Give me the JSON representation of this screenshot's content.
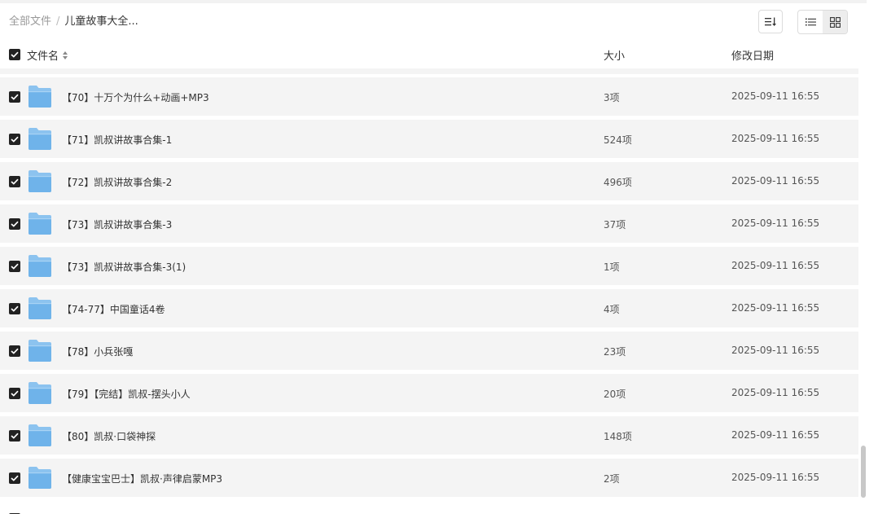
{
  "breadcrumb": {
    "root": "全部文件",
    "separator": "/",
    "current": "儿童故事大全..."
  },
  "toolbar": {
    "sort_icon": "sort-icon",
    "view_list_icon": "list-view-icon",
    "view_grid_icon": "grid-view-icon",
    "active_view": "grid"
  },
  "columns": {
    "name": "文件名",
    "size": "大小",
    "date": "修改日期"
  },
  "rows": [
    {
      "name": "【70】十万个为什么+动画+MP3",
      "size": "3项",
      "date": "2025-09-11 16:55"
    },
    {
      "name": "【71】凯叔讲故事合集-1",
      "size": "524项",
      "date": "2025-09-11 16:55"
    },
    {
      "name": "【72】凯叔讲故事合集-2",
      "size": "496项",
      "date": "2025-09-11 16:55"
    },
    {
      "name": "【73】凯叔讲故事合集-3",
      "size": "37项",
      "date": "2025-09-11 16:55"
    },
    {
      "name": "【73】凯叔讲故事合集-3(1)",
      "size": "1项",
      "date": "2025-09-11 16:55"
    },
    {
      "name": "【74-77】中国童话4卷",
      "size": "4项",
      "date": "2025-09-11 16:55"
    },
    {
      "name": "【78】小兵张嘎",
      "size": "23项",
      "date": "2025-09-11 16:55"
    },
    {
      "name": "【79】【完结】凯叔-摆头小人",
      "size": "20项",
      "date": "2025-09-11 16:55"
    },
    {
      "name": "【80】凯叔·口袋神探",
      "size": "148项",
      "date": "2025-09-11 16:55"
    },
    {
      "name": "【健康宝宝巴士】凯叔·声律启蒙MP3",
      "size": "2项",
      "date": "2025-09-11 16:55"
    }
  ],
  "colors": {
    "row_background": "#f4f4f4",
    "checkbox": "#222222",
    "folder": "#6fb3ea"
  }
}
